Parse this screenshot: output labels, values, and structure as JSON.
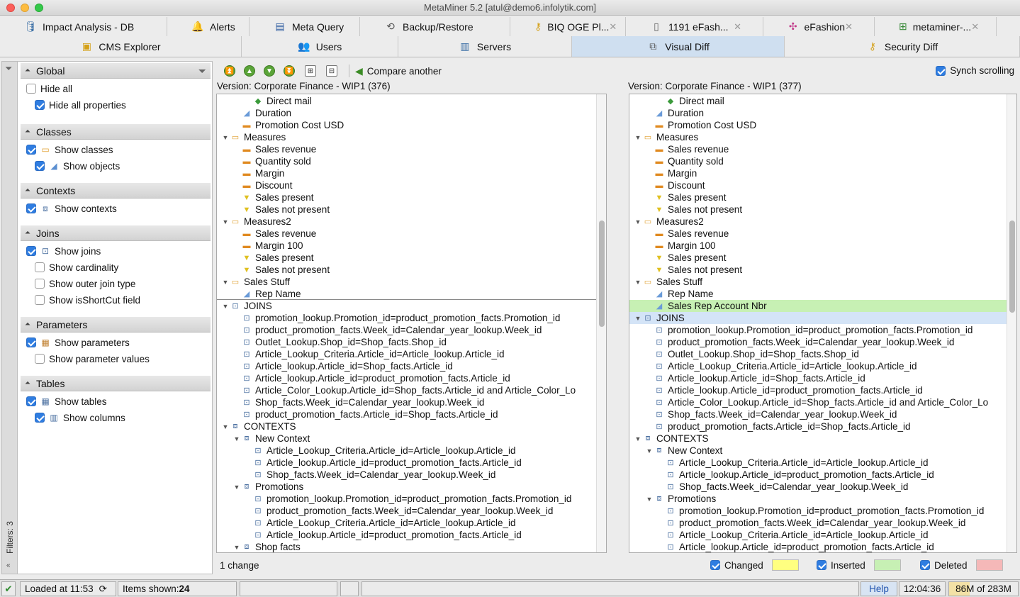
{
  "window": {
    "title": "MetaMiner 5.2 [atul@demo6.infolytik.com]"
  },
  "tabs_row1": [
    {
      "label": "Impact Analysis - DB",
      "icon": "database-icon",
      "closable": false
    },
    {
      "label": "Alerts",
      "icon": "bell-icon",
      "closable": false
    },
    {
      "label": "Meta Query",
      "icon": "sql-icon",
      "closable": false
    },
    {
      "label": "Backup/Restore",
      "icon": "restore-icon",
      "closable": false
    },
    {
      "label": "BIQ OGE Pl...",
      "icon": "key-icon",
      "closable": true
    },
    {
      "label": "1191 eFash...",
      "icon": "document-icon",
      "closable": true
    },
    {
      "label": "eFashion",
      "icon": "universe-icon",
      "closable": true
    },
    {
      "label": "metaminer-...",
      "icon": "hierarchy-icon",
      "closable": true
    }
  ],
  "tabs_row2": [
    {
      "label": "CMS Explorer",
      "icon": "cms-icon",
      "active": false
    },
    {
      "label": "Users",
      "icon": "users-icon",
      "active": false
    },
    {
      "label": "Servers",
      "icon": "servers-icon",
      "active": false
    },
    {
      "label": "Visual Diff",
      "icon": "visual-diff-icon",
      "active": true
    },
    {
      "label": "Security Diff",
      "icon": "key-icon",
      "active": false
    }
  ],
  "filters": {
    "strip_label": "Filters: 3",
    "sections": [
      {
        "title": "Global",
        "options": [
          {
            "label": "Hide all",
            "checked": false,
            "indent": 0
          },
          {
            "label": "Hide all properties",
            "checked": true,
            "indent": 1
          }
        ]
      },
      {
        "title": "Classes",
        "options": [
          {
            "label": "Show classes",
            "checked": true,
            "indent": 0,
            "icon": "folder-icon"
          },
          {
            "label": "Show objects",
            "checked": true,
            "indent": 1,
            "icon": "object-icon"
          }
        ]
      },
      {
        "title": "Contexts",
        "options": [
          {
            "label": "Show contexts",
            "checked": true,
            "indent": 0,
            "icon": "context-icon"
          }
        ]
      },
      {
        "title": "Joins",
        "options": [
          {
            "label": "Show joins",
            "checked": true,
            "indent": 0,
            "icon": "join-icon"
          },
          {
            "label": "Show cardinality",
            "checked": false,
            "indent": 1
          },
          {
            "label": "Show outer join type",
            "checked": false,
            "indent": 1
          },
          {
            "label": "Show isShortCut field",
            "checked": false,
            "indent": 1
          }
        ]
      },
      {
        "title": "Parameters",
        "options": [
          {
            "label": "Show parameters",
            "checked": true,
            "indent": 0,
            "icon": "parameter-icon"
          },
          {
            "label": "Show parameter values",
            "checked": false,
            "indent": 1
          }
        ]
      },
      {
        "title": "Tables",
        "options": [
          {
            "label": "Show tables",
            "checked": true,
            "indent": 0,
            "icon": "table-icon"
          },
          {
            "label": "Show columns",
            "checked": true,
            "indent": 1,
            "icon": "column-icon"
          }
        ]
      }
    ]
  },
  "toolbar": {
    "compare_label": "Compare another",
    "synch_label": "Synch scrolling",
    "synch_checked": true
  },
  "left_version": "Version: Corporate Finance - WIP1 (376)",
  "right_version": "Version: Corporate Finance - WIP1 (377)",
  "left_tree": [
    {
      "text": "Direct mail",
      "level": 3,
      "icon": "dimension"
    },
    {
      "text": "Duration",
      "level": 2,
      "icon": "detail"
    },
    {
      "text": "Promotion Cost USD",
      "level": 2,
      "icon": "measure"
    },
    {
      "text": "Measures",
      "level": 1,
      "icon": "folder",
      "expanded": true
    },
    {
      "text": "Sales revenue",
      "level": 2,
      "icon": "measure"
    },
    {
      "text": "Quantity sold",
      "level": 2,
      "icon": "measure"
    },
    {
      "text": "Margin",
      "level": 2,
      "icon": "measure"
    },
    {
      "text": "Discount",
      "level": 2,
      "icon": "measure"
    },
    {
      "text": "Sales present",
      "level": 2,
      "icon": "filter"
    },
    {
      "text": "Sales not present",
      "level": 2,
      "icon": "filter"
    },
    {
      "text": "Measures2",
      "level": 1,
      "icon": "folder",
      "expanded": true
    },
    {
      "text": "Sales revenue",
      "level": 2,
      "icon": "measure"
    },
    {
      "text": "Margin 100",
      "level": 2,
      "icon": "measure"
    },
    {
      "text": "Sales present",
      "level": 2,
      "icon": "filter"
    },
    {
      "text": "Sales not present",
      "level": 2,
      "icon": "filter"
    },
    {
      "text": "Sales Stuff",
      "level": 1,
      "icon": "folder",
      "expanded": true
    },
    {
      "text": "Rep Name",
      "level": 2,
      "icon": "detail",
      "underline": true
    },
    {
      "text": "JOINS",
      "level": 1,
      "icon": "join",
      "expanded": true
    },
    {
      "text": "promotion_lookup.Promotion_id=product_promotion_facts.Promotion_id",
      "level": 2,
      "icon": "join"
    },
    {
      "text": "product_promotion_facts.Week_id=Calendar_year_lookup.Week_id",
      "level": 2,
      "icon": "join"
    },
    {
      "text": "Outlet_Lookup.Shop_id=Shop_facts.Shop_id",
      "level": 2,
      "icon": "join"
    },
    {
      "text": "Article_Lookup_Criteria.Article_id=Article_lookup.Article_id",
      "level": 2,
      "icon": "join"
    },
    {
      "text": "Article_lookup.Article_id=Shop_facts.Article_id",
      "level": 2,
      "icon": "join"
    },
    {
      "text": "Article_lookup.Article_id=product_promotion_facts.Article_id",
      "level": 2,
      "icon": "join"
    },
    {
      "text": "Article_Color_Lookup.Article_id=Shop_facts.Article_id and Article_Color_Lo",
      "level": 2,
      "icon": "join"
    },
    {
      "text": "Shop_facts.Week_id=Calendar_year_lookup.Week_id",
      "level": 2,
      "icon": "join"
    },
    {
      "text": "product_promotion_facts.Article_id=Shop_facts.Article_id",
      "level": 2,
      "icon": "join"
    },
    {
      "text": "CONTEXTS",
      "level": 1,
      "icon": "context",
      "expanded": true
    },
    {
      "text": "New Context",
      "level": 2,
      "icon": "context",
      "expanded": true
    },
    {
      "text": "Article_Lookup_Criteria.Article_id=Article_lookup.Article_id",
      "level": 3,
      "icon": "join"
    },
    {
      "text": "Article_lookup.Article_id=product_promotion_facts.Article_id",
      "level": 3,
      "icon": "join"
    },
    {
      "text": "Shop_facts.Week_id=Calendar_year_lookup.Week_id",
      "level": 3,
      "icon": "join"
    },
    {
      "text": "Promotions",
      "level": 2,
      "icon": "context",
      "expanded": true
    },
    {
      "text": "promotion_lookup.Promotion_id=product_promotion_facts.Promotion_id",
      "level": 3,
      "icon": "join"
    },
    {
      "text": "product_promotion_facts.Week_id=Calendar_year_lookup.Week_id",
      "level": 3,
      "icon": "join"
    },
    {
      "text": "Article_Lookup_Criteria.Article_id=Article_lookup.Article_id",
      "level": 3,
      "icon": "join"
    },
    {
      "text": "Article_lookup.Article_id=product_promotion_facts.Article_id",
      "level": 3,
      "icon": "join"
    },
    {
      "text": "Shop facts",
      "level": 2,
      "icon": "context",
      "expanded": true
    }
  ],
  "right_tree": [
    {
      "text": "Direct mail",
      "level": 3,
      "icon": "dimension"
    },
    {
      "text": "Duration",
      "level": 2,
      "icon": "detail"
    },
    {
      "text": "Promotion Cost USD",
      "level": 2,
      "icon": "measure"
    },
    {
      "text": "Measures",
      "level": 1,
      "icon": "folder",
      "expanded": true
    },
    {
      "text": "Sales revenue",
      "level": 2,
      "icon": "measure"
    },
    {
      "text": "Quantity sold",
      "level": 2,
      "icon": "measure"
    },
    {
      "text": "Margin",
      "level": 2,
      "icon": "measure"
    },
    {
      "text": "Discount",
      "level": 2,
      "icon": "measure"
    },
    {
      "text": "Sales present",
      "level": 2,
      "icon": "filter"
    },
    {
      "text": "Sales not present",
      "level": 2,
      "icon": "filter"
    },
    {
      "text": "Measures2",
      "level": 1,
      "icon": "folder",
      "expanded": true
    },
    {
      "text": "Sales revenue",
      "level": 2,
      "icon": "measure"
    },
    {
      "text": "Margin 100",
      "level": 2,
      "icon": "measure"
    },
    {
      "text": "Sales present",
      "level": 2,
      "icon": "filter"
    },
    {
      "text": "Sales not present",
      "level": 2,
      "icon": "filter"
    },
    {
      "text": "Sales Stuff",
      "level": 1,
      "icon": "folder",
      "expanded": true
    },
    {
      "text": "Rep Name",
      "level": 2,
      "icon": "detail"
    },
    {
      "text": "Sales Rep Account Nbr",
      "level": 2,
      "icon": "detail",
      "status": "inserted"
    },
    {
      "text": "JOINS",
      "level": 1,
      "icon": "join",
      "expanded": true,
      "selected": true
    },
    {
      "text": "promotion_lookup.Promotion_id=product_promotion_facts.Promotion_id",
      "level": 2,
      "icon": "join"
    },
    {
      "text": "product_promotion_facts.Week_id=Calendar_year_lookup.Week_id",
      "level": 2,
      "icon": "join"
    },
    {
      "text": "Outlet_Lookup.Shop_id=Shop_facts.Shop_id",
      "level": 2,
      "icon": "join"
    },
    {
      "text": "Article_Lookup_Criteria.Article_id=Article_lookup.Article_id",
      "level": 2,
      "icon": "join"
    },
    {
      "text": "Article_lookup.Article_id=Shop_facts.Article_id",
      "level": 2,
      "icon": "join"
    },
    {
      "text": "Article_lookup.Article_id=product_promotion_facts.Article_id",
      "level": 2,
      "icon": "join"
    },
    {
      "text": "Article_Color_Lookup.Article_id=Shop_facts.Article_id and Article_Color_Lo",
      "level": 2,
      "icon": "join"
    },
    {
      "text": "Shop_facts.Week_id=Calendar_year_lookup.Week_id",
      "level": 2,
      "icon": "join"
    },
    {
      "text": "product_promotion_facts.Article_id=Shop_facts.Article_id",
      "level": 2,
      "icon": "join"
    },
    {
      "text": "CONTEXTS",
      "level": 1,
      "icon": "context",
      "expanded": true
    },
    {
      "text": "New Context",
      "level": 2,
      "icon": "context",
      "expanded": true
    },
    {
      "text": "Article_Lookup_Criteria.Article_id=Article_lookup.Article_id",
      "level": 3,
      "icon": "join"
    },
    {
      "text": "Article_lookup.Article_id=product_promotion_facts.Article_id",
      "level": 3,
      "icon": "join"
    },
    {
      "text": "Shop_facts.Week_id=Calendar_year_lookup.Week_id",
      "level": 3,
      "icon": "join"
    },
    {
      "text": "Promotions",
      "level": 2,
      "icon": "context",
      "expanded": true
    },
    {
      "text": "promotion_lookup.Promotion_id=product_promotion_facts.Promotion_id",
      "level": 3,
      "icon": "join"
    },
    {
      "text": "product_promotion_facts.Week_id=Calendar_year_lookup.Week_id",
      "level": 3,
      "icon": "join"
    },
    {
      "text": "Article_Lookup_Criteria.Article_id=Article_lookup.Article_id",
      "level": 3,
      "icon": "join"
    },
    {
      "text": "Article_lookup.Article_id=product_promotion_facts.Article_id",
      "level": 3,
      "icon": "join"
    }
  ],
  "diff_status": {
    "change_count": "1 change",
    "legend": [
      {
        "label": "Changed",
        "checked": true,
        "color": "#ffff80"
      },
      {
        "label": "Inserted",
        "checked": true,
        "color": "#c7f0b4"
      },
      {
        "label": "Deleted",
        "checked": true,
        "color": "#f5b8b8"
      }
    ]
  },
  "statusbar": {
    "loaded": "Loaded at 11:53",
    "items_label": "Items shown: ",
    "items_count": "24",
    "help": "Help",
    "time": "12:04:36",
    "memory": "86M of 283M"
  }
}
